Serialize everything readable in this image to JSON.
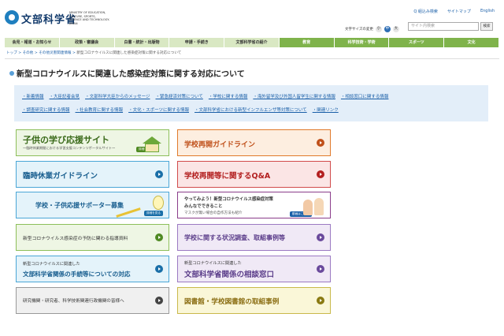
{
  "header": {
    "logo_text": "文部科学省",
    "logo_en_lines": [
      "MINISTRY OF EDUCATION,",
      "CULTURE, SPORTS,",
      "SCIENCE AND TECHNOLOGY-JAPAN"
    ],
    "util_links": [
      "Q 組込み検索",
      "サイトマップ",
      "English"
    ],
    "font_size_label": "文字サイズの変更",
    "font_size_buttons": [
      "小",
      "中",
      "大"
    ],
    "search_placeholder": "サイト内検索",
    "search_button": "検索"
  },
  "nav": [
    {
      "label": "会見・報道・お知らせ",
      "active": false
    },
    {
      "label": "政策・審議会",
      "active": false
    },
    {
      "label": "白書・統計・出版物",
      "active": false
    },
    {
      "label": "申請・手続き",
      "active": false
    },
    {
      "label": "文部科学省の紹介",
      "active": false
    },
    {
      "label": "教育",
      "active": true
    },
    {
      "label": "科学技術・学術",
      "active": true
    },
    {
      "label": "スポーツ",
      "active": true
    },
    {
      "label": "文化",
      "active": true
    }
  ],
  "breadcrumb": {
    "items": [
      "トップ",
      "その他",
      "その他災害関連情報"
    ],
    "separator": " > ",
    "current": "新型コロナウイルスに関連した感染症対策に関する対応について"
  },
  "page_title": "新型コロナウイルスに関連した感染症対策に関する対応について",
  "topics_row1": [
    "新着情報",
    "大臣記者会見",
    "文部科学大臣からのメッセージ",
    "緊急経済対策について",
    "学校に関する情報",
    "海外留学及び外国人留学生に関する情報",
    "相談窓口に関する情報"
  ],
  "topics_row2": [
    "調査研究に関する情報",
    "社会教育に関する情報",
    "文化・スポーツに関する情報",
    "文部科学省における新型インフルエンザ等対策について",
    "関連リンク"
  ],
  "banners": {
    "learning_support": {
      "title": "子供の学び応援サイト",
      "sub": "〜臨時休業期間における学習支援コンテンツポータルサイト〜",
      "badge": "詳細を見る"
    },
    "reopening_guideline": {
      "title": "学校再開ガイドライン"
    },
    "closure_guideline": {
      "title": "臨時休業ガイドライン"
    },
    "reopening_qa": {
      "title": "学校再開等に関するQ&A"
    },
    "supporter": {
      "title": "学校・子供応援サポーター募集",
      "badge": "詳細を見る"
    },
    "try_it": {
      "line1": "やってみよう！新型コロナウイルス感染症対策",
      "line2": "みんなでできること",
      "line3": "マスクが無い場合の自作方法も紹介",
      "badge": "動画はこちら"
    },
    "prevention": {
      "title": "新型コロナウイルス感染症の予防に関わる指導資料"
    },
    "survey": {
      "title": "学校に関する状況調査、取組事例等"
    },
    "procedures": {
      "line1": "新型コロナウイルスに関連した",
      "line2": "文部科学省関係の手続等についての対応"
    },
    "consultation": {
      "line1": "新型コロナウイルスに関連した",
      "line2": "文部科学省関係の相談窓口"
    },
    "research": {
      "title": "研究機関・研究者、科学技術関連行政機関の皆様へ"
    },
    "library": {
      "title": "図書館・学校図書館の取組事例"
    }
  },
  "colors": {
    "nav_active": "#7fb34b",
    "nav_inactive": "#d9e8c3",
    "topic_box": "#e3eef9",
    "link": "#1a5fa8"
  }
}
